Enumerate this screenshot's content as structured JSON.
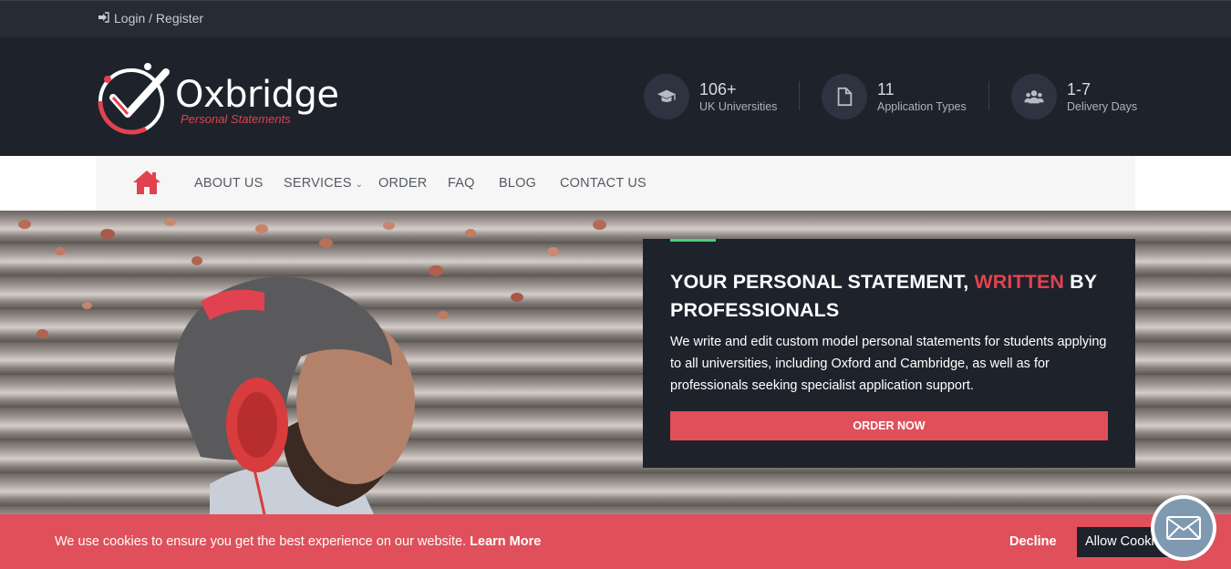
{
  "topbar": {
    "login_label": "Login / Register",
    "login_icon": "sign-in-icon"
  },
  "logo": {
    "name": "Oxbridge",
    "tagline": "Personal Statements"
  },
  "stats": [
    {
      "icon": "graduation-cap-icon",
      "value": "106+",
      "label": "UK Universities"
    },
    {
      "icon": "document-icon",
      "value": "11",
      "label": "Application Types"
    },
    {
      "icon": "users-icon",
      "value": "1-7",
      "label": "Delivery Days"
    }
  ],
  "nav": {
    "home_icon": "home-icon",
    "items": [
      {
        "label": "ABOUT US"
      },
      {
        "label": "SERVICES",
        "dropdown": true
      },
      {
        "label": "ORDER"
      },
      {
        "label": "FAQ"
      },
      {
        "label": "BLOG"
      },
      {
        "label": "CONTACT US"
      }
    ]
  },
  "hero": {
    "title_part1": "YOUR PERSONAL STATEMENT, ",
    "title_highlight": "WRITTEN",
    "title_part2": " BY PROFESSIONALS",
    "description": "We write and edit custom model personal statements for students applying to all universities, including Oxford and Cambridge, as well as for professionals seeking specialist application support.",
    "cta_label": "ORDER NOW"
  },
  "cookie": {
    "message": "We use cookies to ensure you get the best experience on our website.",
    "learn_more": "Learn More",
    "decline": "Decline",
    "allow": "Allow Cookies"
  },
  "colors": {
    "accent": "#e0434f",
    "dark": "#1e222b",
    "green": "#4cd07d"
  }
}
